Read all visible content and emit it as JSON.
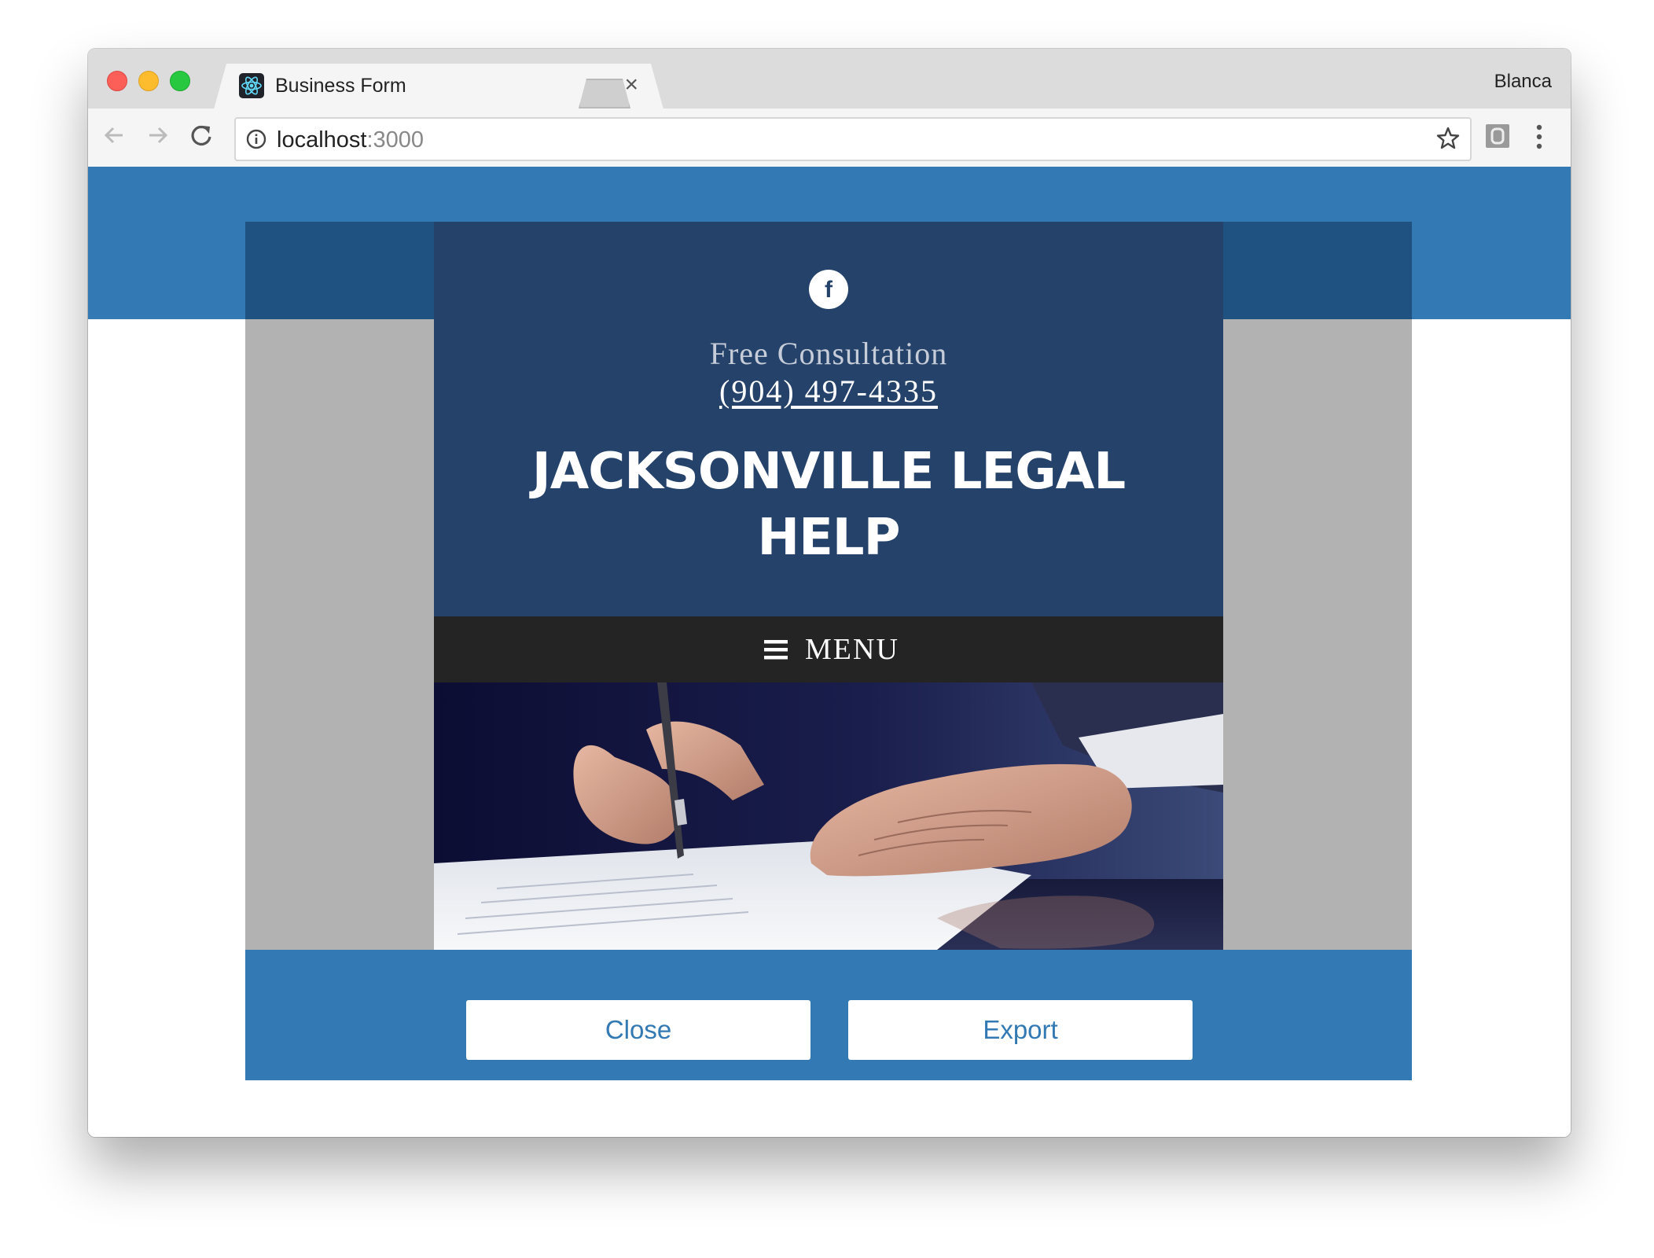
{
  "browser": {
    "tab_title": "Business Form",
    "profile_name": "Blanca",
    "url_host": "localhost",
    "url_port": ":3000"
  },
  "site": {
    "consultation_text": "Free Consultation",
    "phone": "(904) 497-4335",
    "title": "JACKSONVILLE LEGAL HELP",
    "menu_label": "MENU",
    "social_icon": "f"
  },
  "modal": {
    "close_label": "Close",
    "export_label": "Export"
  },
  "colors": {
    "page_blue": "#3379b4",
    "site_navy": "#25426b",
    "menu_dark": "#242424",
    "preview_gray": "#b2b2b2"
  }
}
